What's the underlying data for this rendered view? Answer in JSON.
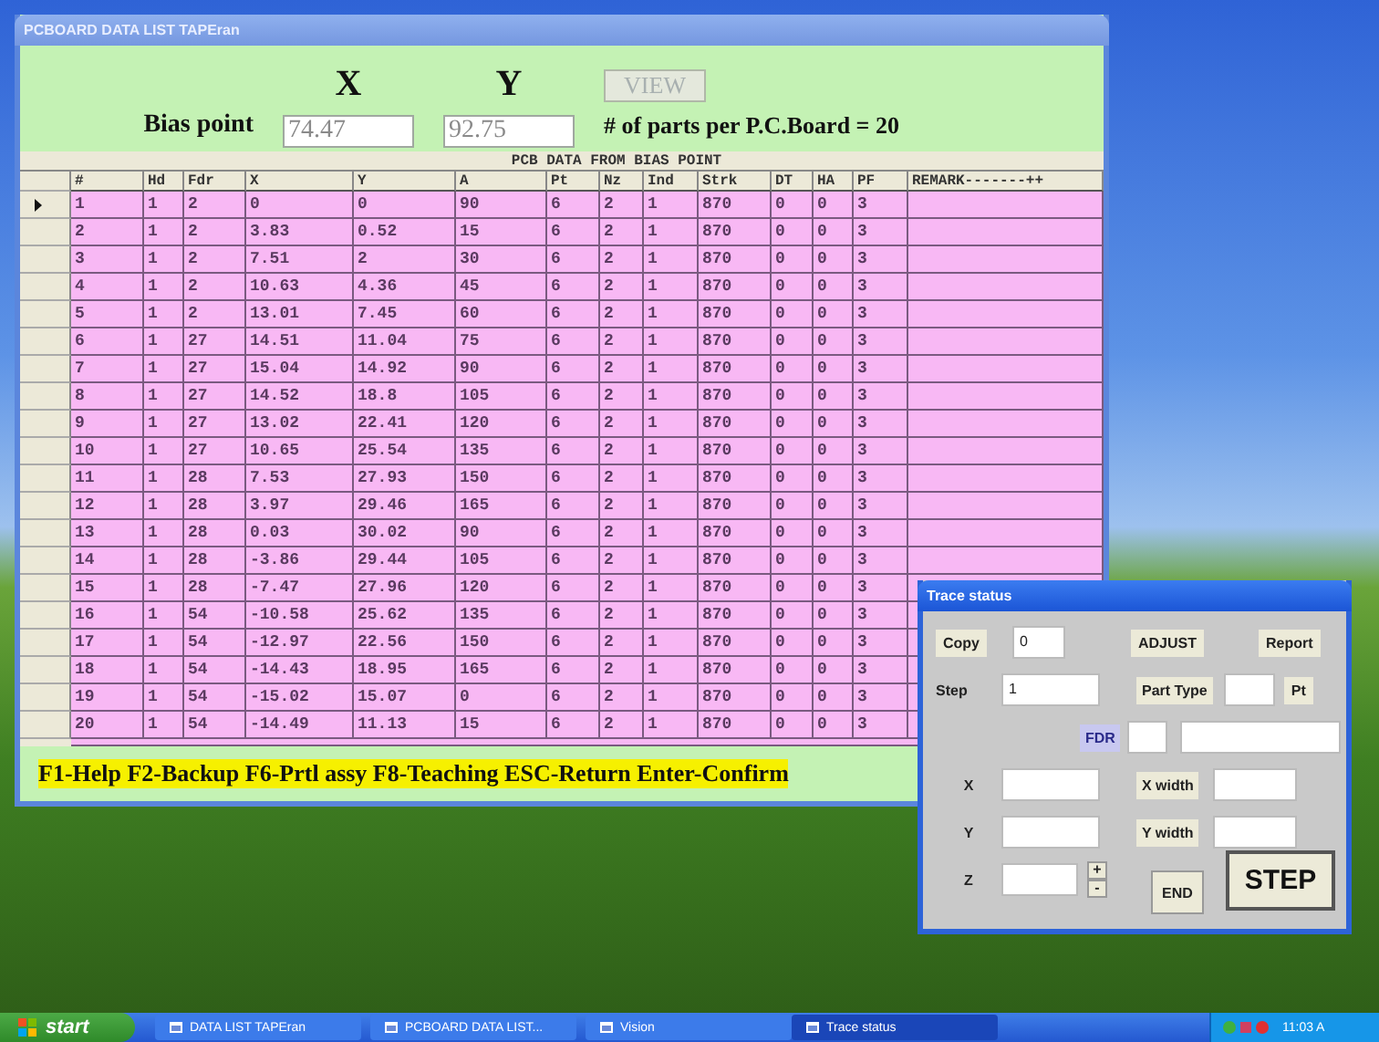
{
  "main_window": {
    "title": "PCBOARD DATA LIST TAPEran",
    "bias": {
      "label": "Bias point",
      "x_heading": "X",
      "y_heading": "Y",
      "x_value": "74.47",
      "y_value": "92.75"
    },
    "view_button": {
      "label": "VIEW",
      "disabled": true
    },
    "parts_count": "# of parts per P.C.Board = 20",
    "table": {
      "caption": "PCB DATA FROM BIAS POINT",
      "columns": [
        "#",
        "Hd",
        "Fdr",
        "X",
        "Y",
        "A",
        "Pt",
        "Nz",
        "Ind",
        "Strk",
        "DT",
        "HA",
        "PF",
        "REMARK-------++"
      ],
      "rows": [
        {
          "selected": true,
          "cells": [
            "1",
            "1",
            "2",
            "0",
            "0",
            "90",
            "6",
            "2",
            "1",
            "870",
            "0",
            "0",
            "3",
            ""
          ]
        },
        {
          "selected": false,
          "cells": [
            "2",
            "1",
            "2",
            "3.83",
            "0.52",
            "15",
            "6",
            "2",
            "1",
            "870",
            "0",
            "0",
            "3",
            ""
          ]
        },
        {
          "selected": false,
          "cells": [
            "3",
            "1",
            "2",
            "7.51",
            "2",
            "30",
            "6",
            "2",
            "1",
            "870",
            "0",
            "0",
            "3",
            ""
          ]
        },
        {
          "selected": false,
          "cells": [
            "4",
            "1",
            "2",
            "10.63",
            "4.36",
            "45",
            "6",
            "2",
            "1",
            "870",
            "0",
            "0",
            "3",
            ""
          ]
        },
        {
          "selected": false,
          "cells": [
            "5",
            "1",
            "2",
            "13.01",
            "7.45",
            "60",
            "6",
            "2",
            "1",
            "870",
            "0",
            "0",
            "3",
            ""
          ]
        },
        {
          "selected": false,
          "cells": [
            "6",
            "1",
            "27",
            "14.51",
            "11.04",
            "75",
            "6",
            "2",
            "1",
            "870",
            "0",
            "0",
            "3",
            ""
          ]
        },
        {
          "selected": false,
          "cells": [
            "7",
            "1",
            "27",
            "15.04",
            "14.92",
            "90",
            "6",
            "2",
            "1",
            "870",
            "0",
            "0",
            "3",
            ""
          ]
        },
        {
          "selected": false,
          "cells": [
            "8",
            "1",
            "27",
            "14.52",
            "18.8",
            "105",
            "6",
            "2",
            "1",
            "870",
            "0",
            "0",
            "3",
            ""
          ]
        },
        {
          "selected": false,
          "cells": [
            "9",
            "1",
            "27",
            "13.02",
            "22.41",
            "120",
            "6",
            "2",
            "1",
            "870",
            "0",
            "0",
            "3",
            ""
          ]
        },
        {
          "selected": false,
          "cells": [
            "10",
            "1",
            "27",
            "10.65",
            "25.54",
            "135",
            "6",
            "2",
            "1",
            "870",
            "0",
            "0",
            "3",
            ""
          ]
        },
        {
          "selected": false,
          "cells": [
            "11",
            "1",
            "28",
            "7.53",
            "27.93",
            "150",
            "6",
            "2",
            "1",
            "870",
            "0",
            "0",
            "3",
            ""
          ]
        },
        {
          "selected": false,
          "cells": [
            "12",
            "1",
            "28",
            "3.97",
            "29.46",
            "165",
            "6",
            "2",
            "1",
            "870",
            "0",
            "0",
            "3",
            ""
          ]
        },
        {
          "selected": false,
          "cells": [
            "13",
            "1",
            "28",
            "0.03",
            "30.02",
            "90",
            "6",
            "2",
            "1",
            "870",
            "0",
            "0",
            "3",
            ""
          ]
        },
        {
          "selected": false,
          "cells": [
            "14",
            "1",
            "28",
            "-3.86",
            "29.44",
            "105",
            "6",
            "2",
            "1",
            "870",
            "0",
            "0",
            "3",
            ""
          ]
        },
        {
          "selected": false,
          "cells": [
            "15",
            "1",
            "28",
            "-7.47",
            "27.96",
            "120",
            "6",
            "2",
            "1",
            "870",
            "0",
            "0",
            "3",
            ""
          ]
        },
        {
          "selected": false,
          "cells": [
            "16",
            "1",
            "54",
            "-10.58",
            "25.62",
            "135",
            "6",
            "2",
            "1",
            "870",
            "0",
            "0",
            "3",
            ""
          ]
        },
        {
          "selected": false,
          "cells": [
            "17",
            "1",
            "54",
            "-12.97",
            "22.56",
            "150",
            "6",
            "2",
            "1",
            "870",
            "0",
            "0",
            "3",
            ""
          ]
        },
        {
          "selected": false,
          "cells": [
            "18",
            "1",
            "54",
            "-14.43",
            "18.95",
            "165",
            "6",
            "2",
            "1",
            "870",
            "0",
            "0",
            "3",
            ""
          ]
        },
        {
          "selected": false,
          "cells": [
            "19",
            "1",
            "54",
            "-15.02",
            "15.07",
            "0",
            "6",
            "2",
            "1",
            "870",
            "0",
            "0",
            "3",
            ""
          ]
        },
        {
          "selected": false,
          "cells": [
            "20",
            "1",
            "54",
            "-14.49",
            "11.13",
            "15",
            "6",
            "2",
            "1",
            "870",
            "0",
            "0",
            "3",
            ""
          ]
        }
      ]
    },
    "footer": "F1-Help F2-Backup F6-Prtl assy F8-Teaching ESC-Return Enter-Confirm"
  },
  "trace_window": {
    "title": "Trace status",
    "copy_button": "Copy",
    "copy_value": "0",
    "adjust_button": "ADJUST",
    "report_button": "Report",
    "step_label": "Step",
    "step_value": "1",
    "part_type_label": "Part Type",
    "pt_button": "Pt",
    "fdr_label": "FDR",
    "x_label": "X",
    "y_label": "Y",
    "z_label": "Z",
    "x_width_label": "X width",
    "y_width_label": "Y width",
    "plus_button": "+",
    "minus_button": "-",
    "end_button": "END",
    "step_button": "STEP"
  },
  "taskbar": {
    "start": "start",
    "items": [
      {
        "label": "DATA LIST  TAPEran",
        "selected": false
      },
      {
        "label": "PCBOARD DATA LIST...",
        "selected": false
      },
      {
        "label": "Vision",
        "selected": false
      },
      {
        "label": "Trace status",
        "selected": true
      }
    ],
    "clock": "11:03 A"
  }
}
